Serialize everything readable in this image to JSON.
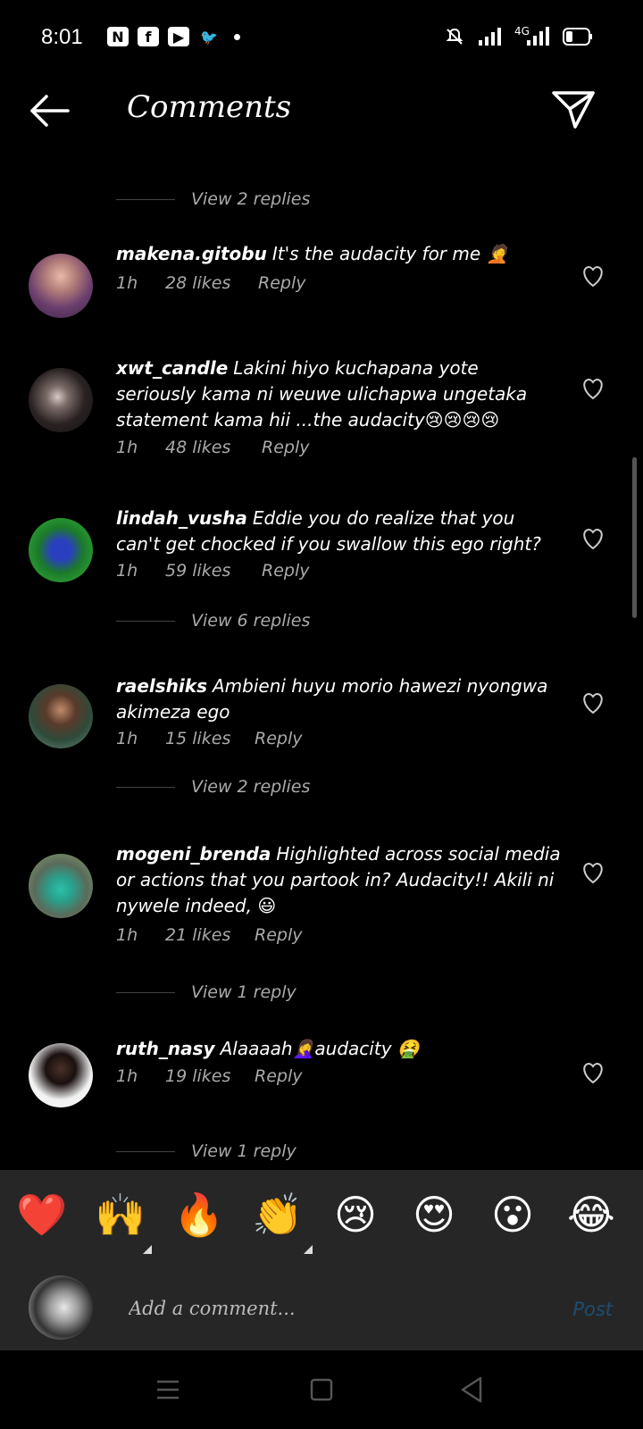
{
  "status_bar": {
    "time": "8:01",
    "apps": [
      "N",
      "f",
      "▶",
      "🐦"
    ],
    "network": "4G"
  },
  "header": {
    "title": "Comments"
  },
  "partial_view_replies": "View 2 replies",
  "comments": [
    {
      "user": "makena.gitobu",
      "text": "It's the audacity for me 🤦",
      "time": "1h",
      "likes": "28 likes",
      "reply": "Reply",
      "replies": ""
    },
    {
      "user": "xwt_candle",
      "text": "Lakini hiyo kuchapana yote seriously kama ni weuwe ulichapwa ungetaka statement kama hii ...the audacity😢😢😢😢",
      "time": "1h",
      "likes": "48 likes",
      "reply": "Reply",
      "replies": ""
    },
    {
      "user": "lindah_vusha",
      "text": "Eddie you do realize that you can't get chocked if you swallow this ego right?",
      "time": "1h",
      "likes": "59 likes",
      "reply": "Reply",
      "replies": "View 6 replies"
    },
    {
      "user": "raelshiks",
      "text": "Ambieni huyu morio hawezi nyongwa akimeza ego",
      "time": "1h",
      "likes": "15 likes",
      "reply": "Reply",
      "replies": "View 2 replies"
    },
    {
      "user": "mogeni_brenda",
      "text": "Highlighted across social media or actions that you partook in? Audacity!! Akili ni nywele indeed, 😃",
      "time": "1h",
      "likes": "21 likes",
      "reply": "Reply",
      "replies": "View 1 reply"
    },
    {
      "user": "ruth_nasy",
      "text": "Alaaaah🤦‍♀️audacity 🤮",
      "time": "1h",
      "likes": "19 likes",
      "reply": "Reply",
      "replies": "View 1 reply"
    }
  ],
  "emoji_bar": [
    "❤️",
    "🙌",
    "🔥",
    "👏",
    "😢",
    "😍",
    "😮",
    "😂"
  ],
  "composer": {
    "placeholder": "Add a comment...",
    "post_label": "Post"
  },
  "colors": {
    "background": "#000000",
    "bar": "#262626",
    "post": "#1c4e72"
  }
}
